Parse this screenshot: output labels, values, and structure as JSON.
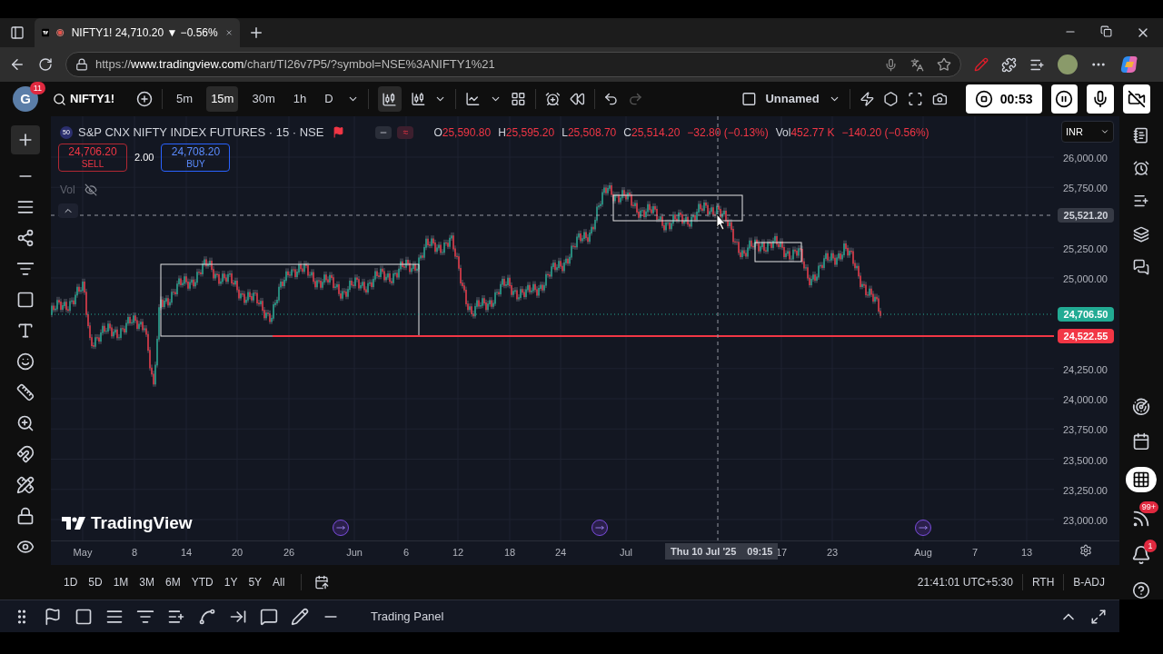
{
  "browser": {
    "tab_title": "NIFTY1! 24,710.20 ▼ −0.56%",
    "url_prefix": "https://",
    "url_host": "www.tradingview.com",
    "url_path": "/chart/TI26v7P5/?symbol=NSE%3ANIFTY1%21"
  },
  "toolbar": {
    "avatar": "G",
    "badge": "11",
    "symbol": "NIFTY1!",
    "intervals": [
      {
        "label": "5m",
        "selected": false
      },
      {
        "label": "15m",
        "selected": true
      },
      {
        "label": "30m",
        "selected": false
      },
      {
        "label": "1h",
        "selected": false
      },
      {
        "label": "D",
        "selected": false
      }
    ],
    "layout_name": "Unnamed",
    "timer": "00:53"
  },
  "legend": {
    "badge": "50",
    "title": "S&P CNX NIFTY INDEX FUTURES · 15 · NSE",
    "ohlc": [
      {
        "label": "O",
        "value": "25,590.80"
      },
      {
        "label": "H",
        "value": "25,595.20"
      },
      {
        "label": "L",
        "value": "25,508.70"
      },
      {
        "label": "C",
        "value": "25,514.20"
      }
    ],
    "compare_symbol": "≈",
    "change": "−32.80 (−0.13%)",
    "vol_label": "Vol",
    "vol_value": "452.77 K",
    "vol_change": "−140.20 (−0.56%)",
    "sell": {
      "price": "24,706.20",
      "label": "SELL"
    },
    "spread": "2.00",
    "buy": {
      "price": "24,708.20",
      "label": "BUY"
    },
    "volume_indicator": "Vol"
  },
  "currency": "INR",
  "price_axis": [
    "26,000.00",
    "25,750.00",
    "25,250.00",
    "25,000.00",
    "24,250.00",
    "24,000.00",
    "23,750.00",
    "23,500.00",
    "23,250.00",
    "23,000.00"
  ],
  "price_tags": [
    {
      "text": "25,521.20",
      "kind": "crosshair",
      "color": "#363a45"
    },
    {
      "text": "24,706.50",
      "kind": "last",
      "color": "#22ab94"
    },
    {
      "text": "24,522.55",
      "kind": "line",
      "color": "#f23645"
    }
  ],
  "time_axis": [
    "May",
    "8",
    "14",
    "20",
    "26",
    "Jun",
    "6",
    "12",
    "18",
    "24",
    "Jul",
    "17",
    "23",
    "Aug",
    "7",
    "13"
  ],
  "crosshair_time": {
    "date": "Thu 10 Jul '25",
    "time": "09:15"
  },
  "logo": "TradingView",
  "ranges": [
    "1D",
    "5D",
    "1M",
    "3M",
    "6M",
    "YTD",
    "1Y",
    "5Y",
    "All"
  ],
  "status": [
    "21:41:01 UTC+5:30",
    "RTH",
    "B-ADJ"
  ],
  "trading_panel": "Trading Panel",
  "sidebar_badges": {
    "news": "99+",
    "alerts": "1"
  }
}
